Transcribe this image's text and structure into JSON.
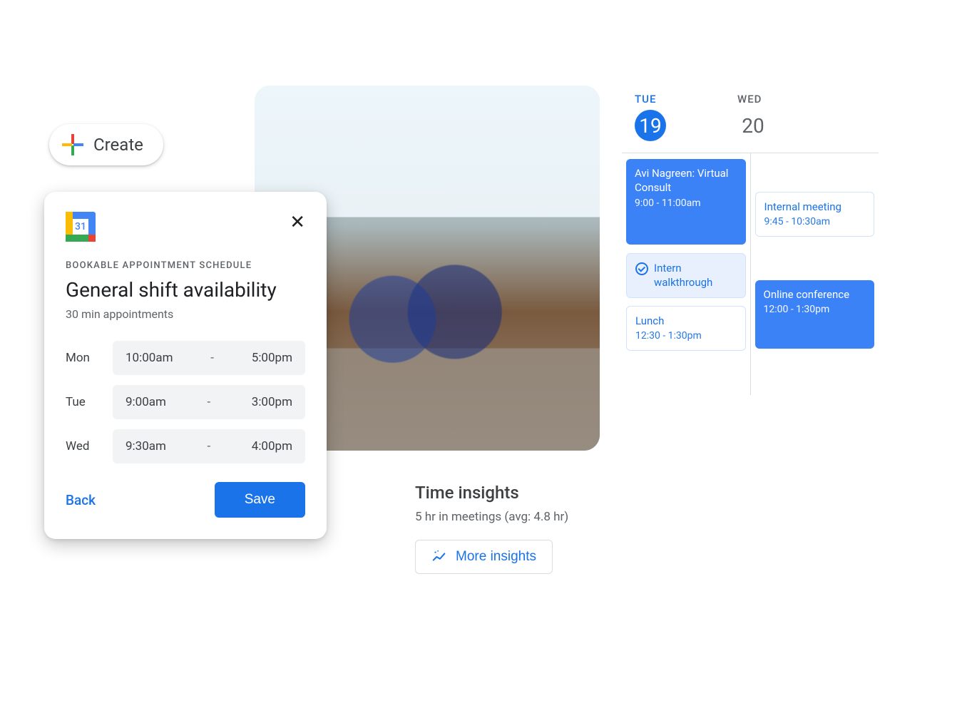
{
  "create": {
    "label": "Create"
  },
  "appointment": {
    "logo_day": "31",
    "eyebrow": "BOOKABLE APPOINTMENT SCHEDULE",
    "title": "General shift availability",
    "subtitle": "30 min appointments",
    "rows": [
      {
        "day": "Mon",
        "start": "10:00am",
        "end": "5:00pm"
      },
      {
        "day": "Tue",
        "start": "9:00am",
        "end": "3:00pm"
      },
      {
        "day": "Wed",
        "start": "9:30am",
        "end": "4:00pm"
      }
    ],
    "back": "Back",
    "save": "Save"
  },
  "calendar": {
    "days": [
      {
        "dow": "TUE",
        "num": "19",
        "active": true
      },
      {
        "dow": "WED",
        "num": "20",
        "active": false
      }
    ],
    "col1": {
      "evt1": {
        "title": "Avi Nagreen: Virtual Consult",
        "time": "9:00 - 11:00am"
      },
      "evt2": {
        "title": "Intern walkthrough"
      },
      "evt3": {
        "title": "Lunch",
        "time": "12:30 - 1:30pm"
      }
    },
    "col2": {
      "evt1": {
        "title": "Internal meeting",
        "time": "9:45 - 10:30am"
      },
      "evt2": {
        "title": "Online conference",
        "time": "12:00 - 1:30pm"
      }
    }
  },
  "insights": {
    "title": "Time insights",
    "sub": "5 hr in meetings (avg: 4.8 hr)",
    "more": "More insights"
  }
}
